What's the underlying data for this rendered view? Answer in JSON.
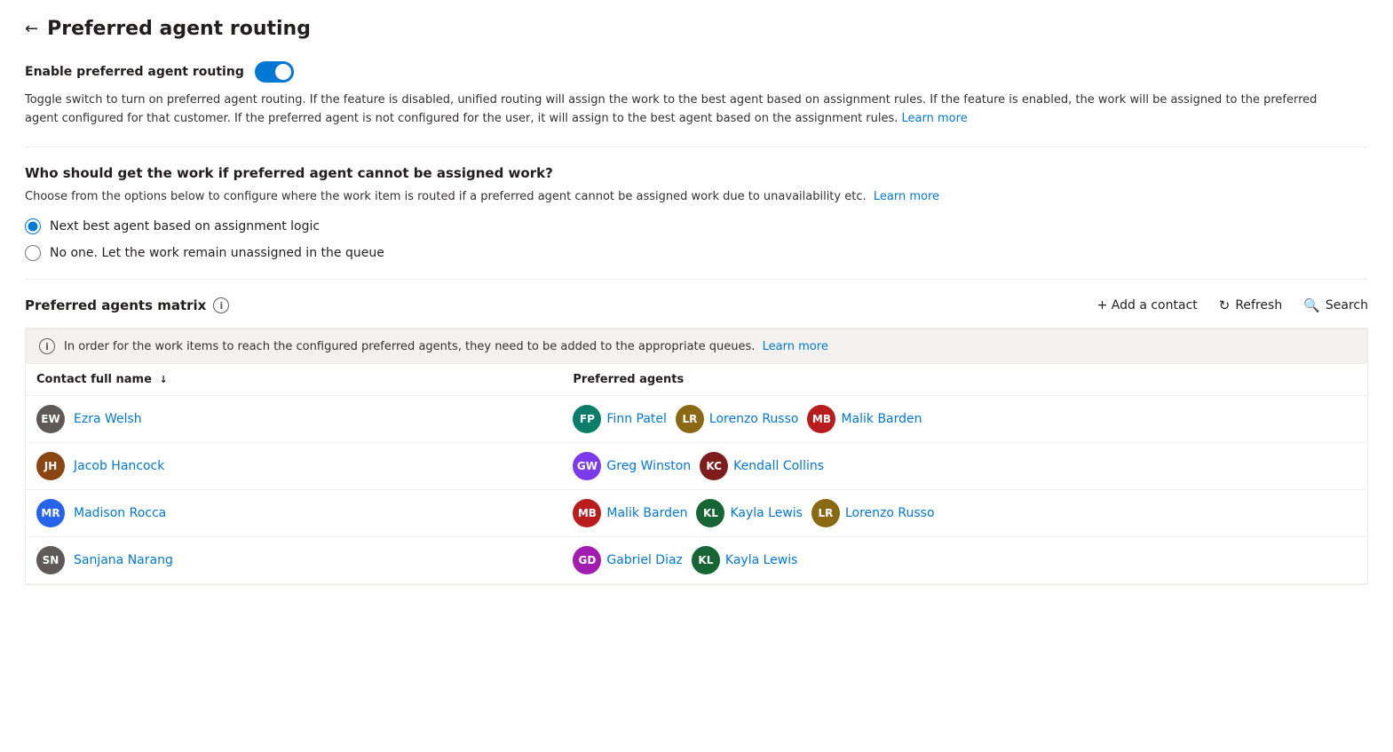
{
  "page": {
    "title": "Preferred agent routing",
    "back_label": "←"
  },
  "toggle_section": {
    "label": "Enable preferred agent routing",
    "enabled": true,
    "description": "Toggle switch to turn on preferred agent routing. If the feature is disabled, unified routing will assign the work to the best agent based on assignment rules. If the feature is enabled, the work will be assigned to the preferred agent configured for that customer. If the preferred agent is not configured for the user, it will assign to the best agent based on the assignment rules.",
    "learn_more_label": "Learn more",
    "learn_more_href": "#"
  },
  "fallback_section": {
    "title": "Who should get the work if preferred agent cannot be assigned work?",
    "description": "Choose from the options below to configure where the work item is routed if a preferred agent cannot be assigned work due to unavailability etc.",
    "learn_more_label": "Learn more",
    "learn_more_href": "#",
    "options": [
      {
        "id": "opt1",
        "label": "Next best agent based on assignment logic",
        "selected": true
      },
      {
        "id": "opt2",
        "label": "No one. Let the work remain unassigned in the queue",
        "selected": false
      }
    ]
  },
  "matrix_section": {
    "title": "Preferred agents matrix",
    "info_icon": "i",
    "actions": {
      "add_contact": "+ Add a contact",
      "refresh": "Refresh",
      "search": "Search"
    },
    "info_banner": {
      "icon": "i",
      "text": "In order for the work items to reach the configured preferred agents, they need to be added to the appropriate queues.",
      "learn_more_label": "Learn more",
      "learn_more_href": "#"
    },
    "table": {
      "columns": [
        {
          "label": "Contact full name",
          "sort": "↓"
        },
        {
          "label": "Preferred agents",
          "sort": ""
        }
      ],
      "rows": [
        {
          "contact": {
            "initials": "EW",
            "name": "Ezra Welsh",
            "color": "#5d5a58"
          },
          "agents": [
            {
              "initials": "FP",
              "name": "Finn Patel",
              "color": "#0a7e6a"
            },
            {
              "initials": "LR",
              "name": "Lorenzo Russo",
              "color": "#8b6914"
            },
            {
              "initials": "MB",
              "name": "Malik Barden",
              "color": "#b91c1c"
            }
          ]
        },
        {
          "contact": {
            "initials": "JH",
            "name": "Jacob Hancock",
            "color": "#8b4513"
          },
          "agents": [
            {
              "initials": "GW",
              "name": "Greg Winston",
              "color": "#7c3aed"
            },
            {
              "initials": "KC",
              "name": "Kendall Collins",
              "color": "#7f1d1d"
            }
          ]
        },
        {
          "contact": {
            "initials": "MR",
            "name": "Madison Rocca",
            "color": "#2563eb"
          },
          "agents": [
            {
              "initials": "MB",
              "name": "Malik Barden",
              "color": "#b91c1c"
            },
            {
              "initials": "KL",
              "name": "Kayla Lewis",
              "color": "#166534"
            },
            {
              "initials": "LR",
              "name": "Lorenzo Russo",
              "color": "#8b6914"
            }
          ]
        },
        {
          "contact": {
            "initials": "SN",
            "name": "Sanjana Narang",
            "color": "#5d5a58"
          },
          "agents": [
            {
              "initials": "GD",
              "name": "Gabriel Diaz",
              "color": "#a21caf"
            },
            {
              "initials": "KL",
              "name": "Kayla Lewis",
              "color": "#166534"
            }
          ]
        }
      ]
    }
  }
}
